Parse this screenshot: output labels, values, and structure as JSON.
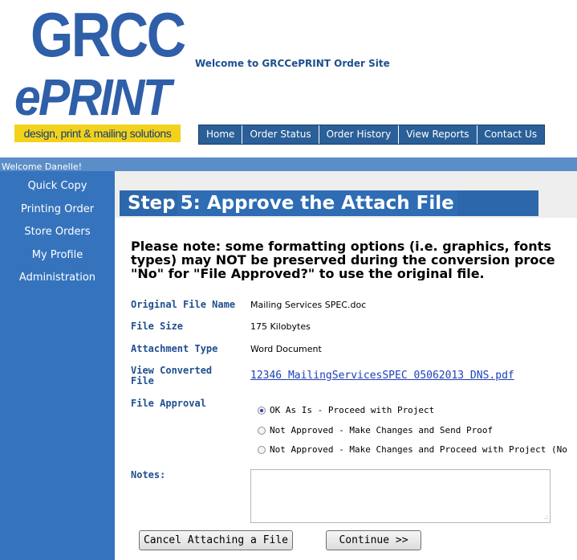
{
  "logo": {
    "line1": "GRCC",
    "line2": "ePRINT",
    "tagline": "design, print & mailing solutions",
    "brand_blue": "#2f5fa8",
    "brand_yellow": "#f2d21a"
  },
  "header": {
    "welcome_site": "Welcome to GRCCePRINT Order Site"
  },
  "topnav": {
    "items": [
      "Home",
      "Order Status",
      "Order History",
      "View Reports",
      "Contact Us"
    ]
  },
  "greeting": "Welcome Danelle!",
  "sidebar": {
    "items": [
      "Quick Copy",
      "Printing Order",
      "Store Orders",
      "My Profile",
      "Administration"
    ]
  },
  "step": {
    "prefix": "Step",
    "title": "5: Approve the Attach File"
  },
  "note": "Please note: some formatting options (i.e. graphics, fonts\ntypes) may NOT be preserved during the conversion proce\n\"No\" for \"File Approved?\" to use the original file.",
  "fields": {
    "original_file_name": {
      "label": "Original File Name",
      "value": "Mailing Services SPEC.doc"
    },
    "file_size": {
      "label": "File Size",
      "value": "175 Kilobytes"
    },
    "attachment_type": {
      "label": "Attachment Type",
      "value": "Word Document"
    },
    "view_converted": {
      "label_line1": "View Converted",
      "label_line2": "File",
      "value": "12346 MailingServicesSPEC 05062013 DNS.pdf"
    },
    "file_approval": {
      "label": "File Approval"
    },
    "notes": {
      "label": "Notes:",
      "value": ""
    }
  },
  "approval_options": [
    {
      "label": "OK As Is - Proceed with Project",
      "selected": true
    },
    {
      "label": "Not Approved - Make Changes and Send Proof",
      "selected": false
    },
    {
      "label": "Not Approved - Make Changes and Proceed with Project (No",
      "selected": false
    }
  ],
  "buttons": {
    "cancel": "Cancel Attaching a File",
    "continue": "Continue >>"
  },
  "colors": {
    "sidebar_bg": "#3574bd",
    "greeting_bar": "#5b8ec8",
    "nav_bg": "#2a5f98",
    "label_blue": "#1f4f8f",
    "link": "#1f40b8"
  }
}
